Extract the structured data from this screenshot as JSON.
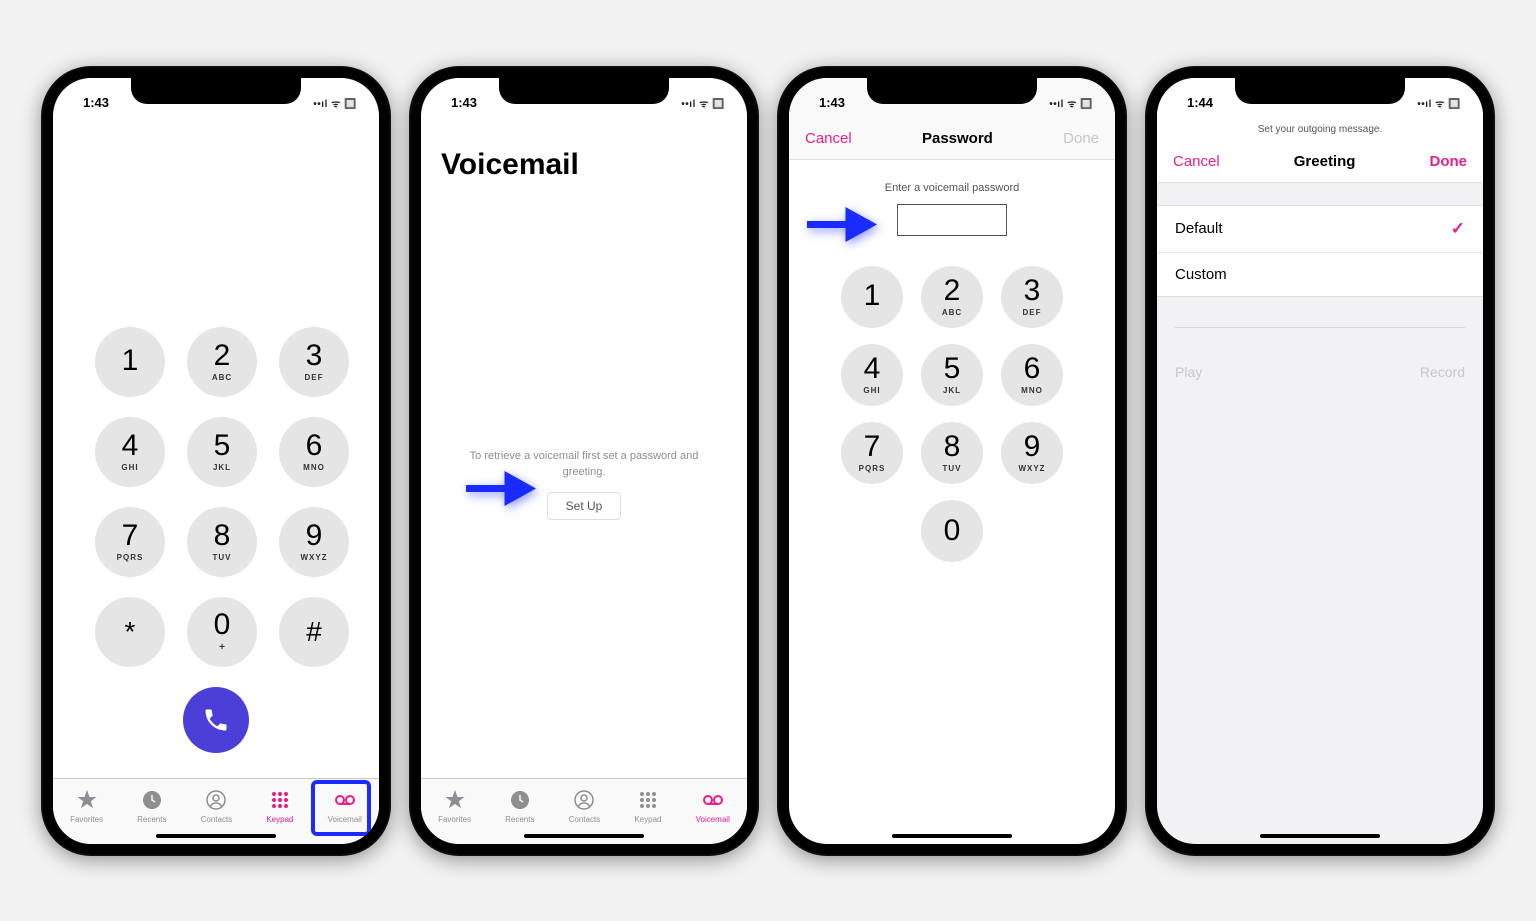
{
  "status": {
    "time1": "1:43",
    "time2": "1:43",
    "time3": "1:43",
    "time4": "1:44",
    "indicators": "📶 📶 🔋"
  },
  "keypad": {
    "keys": [
      {
        "n": "1",
        "s": ""
      },
      {
        "n": "2",
        "s": "ABC"
      },
      {
        "n": "3",
        "s": "DEF"
      },
      {
        "n": "4",
        "s": "GHI"
      },
      {
        "n": "5",
        "s": "JKL"
      },
      {
        "n": "6",
        "s": "MNO"
      },
      {
        "n": "7",
        "s": "PQRS"
      },
      {
        "n": "8",
        "s": "TUV"
      },
      {
        "n": "9",
        "s": "WXYZ"
      },
      {
        "n": "*",
        "s": ""
      },
      {
        "n": "0",
        "s": "+"
      },
      {
        "n": "#",
        "s": ""
      }
    ]
  },
  "tabs": {
    "favorites": "Favorites",
    "recents": "Recents",
    "contacts": "Contacts",
    "keypad": "Keypad",
    "voicemail": "Voicemail"
  },
  "screen2": {
    "title": "Voicemail",
    "msg": "To retrieve a voicemail first set a password and greeting.",
    "setup": "Set Up"
  },
  "screen3": {
    "cancel": "Cancel",
    "title": "Password",
    "done": "Done",
    "prompt": "Enter a voicemail password"
  },
  "screen4": {
    "subheader": "Set your outgoing message.",
    "cancel": "Cancel",
    "title": "Greeting",
    "done": "Done",
    "opt1": "Default",
    "opt2": "Custom",
    "play": "Play",
    "record": "Record"
  }
}
